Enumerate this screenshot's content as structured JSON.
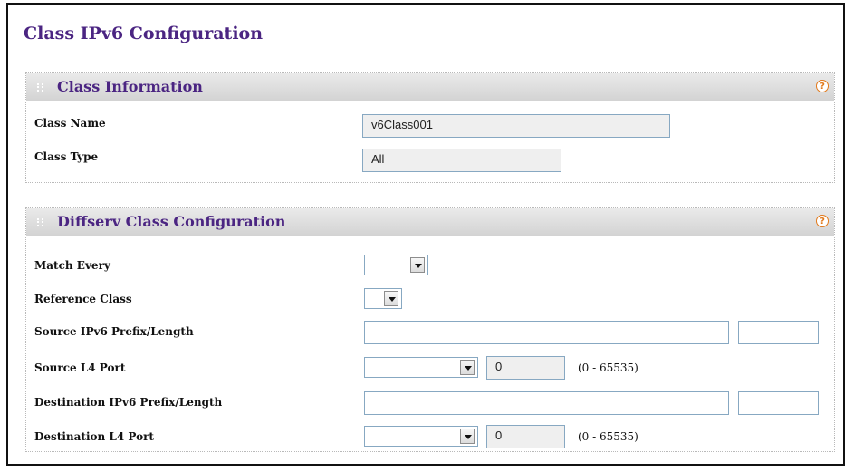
{
  "page": {
    "title": "Class IPv6 Configuration"
  },
  "class_information": {
    "title": "Class Information",
    "help_icon": "?",
    "fields": {
      "class_name": {
        "label": "Class Name",
        "value": "v6Class001"
      },
      "class_type": {
        "label": "Class Type",
        "value": "All"
      }
    }
  },
  "diffserv": {
    "title": "Diffserv Class Configuration",
    "help_icon": "?",
    "match_every": {
      "label": "Match Every",
      "value": ""
    },
    "reference_class": {
      "label": "Reference Class",
      "value": ""
    },
    "source_ipv6": {
      "label": "Source IPv6 Prefix/Length",
      "prefix": "",
      "length": ""
    },
    "source_l4_port": {
      "label": "Source L4 Port",
      "select_value": "",
      "port_value": "0",
      "range": "(0 - 65535)"
    },
    "dest_ipv6": {
      "label": "Destination IPv6 Prefix/Length",
      "prefix": "",
      "length": ""
    },
    "dest_l4_port": {
      "label": "Destination L4 Port",
      "select_value": "",
      "port_value": "0",
      "range": "(0 - 65535)"
    }
  },
  "colors": {
    "title": "#4b2582",
    "help": "#e27a1c",
    "field_border": "#87a8c2",
    "readonly_bg": "#efefef"
  },
  "icons": {
    "help": "help-circle-icon",
    "dropdown": "chevron-down-icon",
    "grip": "grip-dots-icon"
  }
}
